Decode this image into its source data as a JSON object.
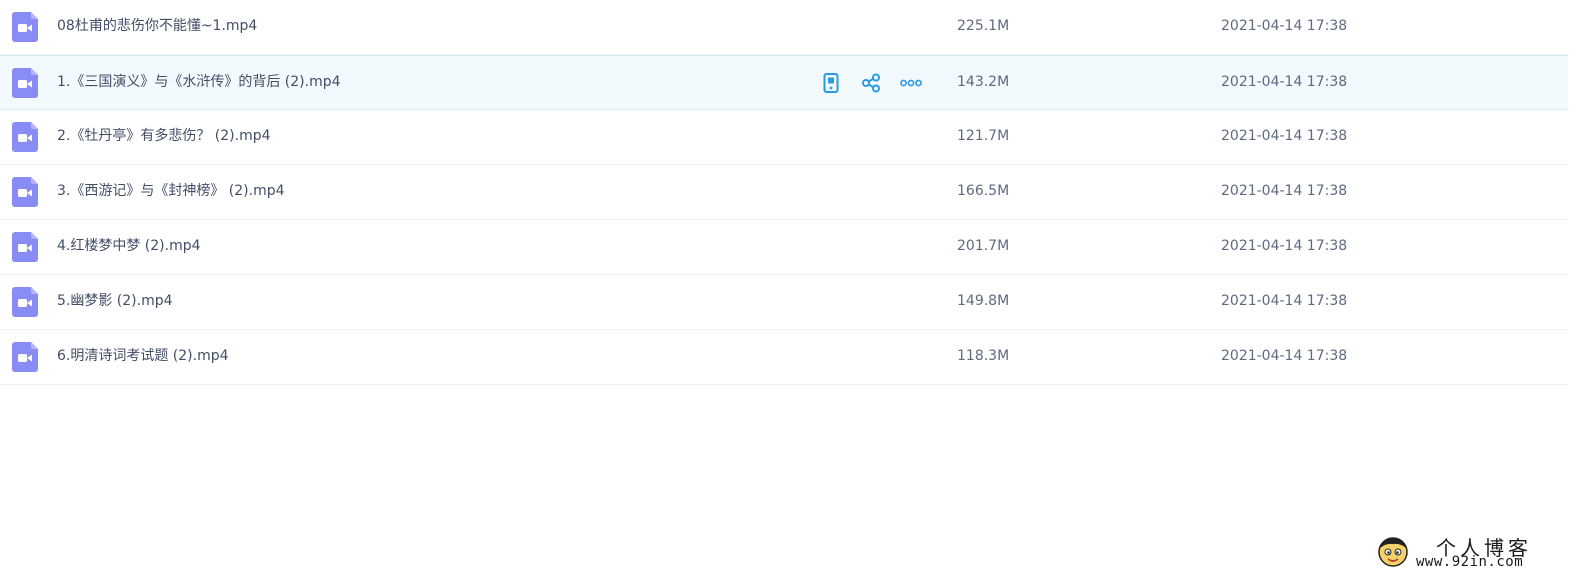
{
  "colors": {
    "video_icon": "#8a8cf5",
    "action_icon": "#2b9ae4",
    "row_hover": "#f2fafd"
  },
  "files": [
    {
      "name": "08杜甫的悲伤你不能懂~1.mp4",
      "size": "225.1M",
      "date": "2021-04-14 17:38",
      "icon": "video-file-icon"
    },
    {
      "name": "1.《三国演义》与《水浒传》的背后 (2).mp4",
      "size": "143.2M",
      "date": "2021-04-14 17:38",
      "icon": "video-file-icon",
      "hovered": true
    },
    {
      "name": "2.《牡丹亭》有多悲伤？ (2).mp4",
      "size": "121.7M",
      "date": "2021-04-14 17:38",
      "icon": "video-file-icon"
    },
    {
      "name": "3.《西游记》与《封神榜》 (2).mp4",
      "size": "166.5M",
      "date": "2021-04-14 17:38",
      "icon": "video-file-icon"
    },
    {
      "name": "4.红楼梦中梦 (2).mp4",
      "size": "201.7M",
      "date": "2021-04-14 17:38",
      "icon": "video-file-icon"
    },
    {
      "name": "5.幽梦影 (2).mp4",
      "size": "149.8M",
      "date": "2021-04-14 17:38",
      "icon": "video-file-icon"
    },
    {
      "name": "6.明清诗词考试题 (2).mp4",
      "size": "118.3M",
      "date": "2021-04-14 17:38",
      "icon": "video-file-icon"
    }
  ],
  "row_actions": [
    {
      "icon": "phone-icon"
    },
    {
      "icon": "share-icon"
    },
    {
      "icon": "more-icon"
    }
  ],
  "watermark": {
    "title": "个人博客",
    "url": "www.92in.com"
  }
}
